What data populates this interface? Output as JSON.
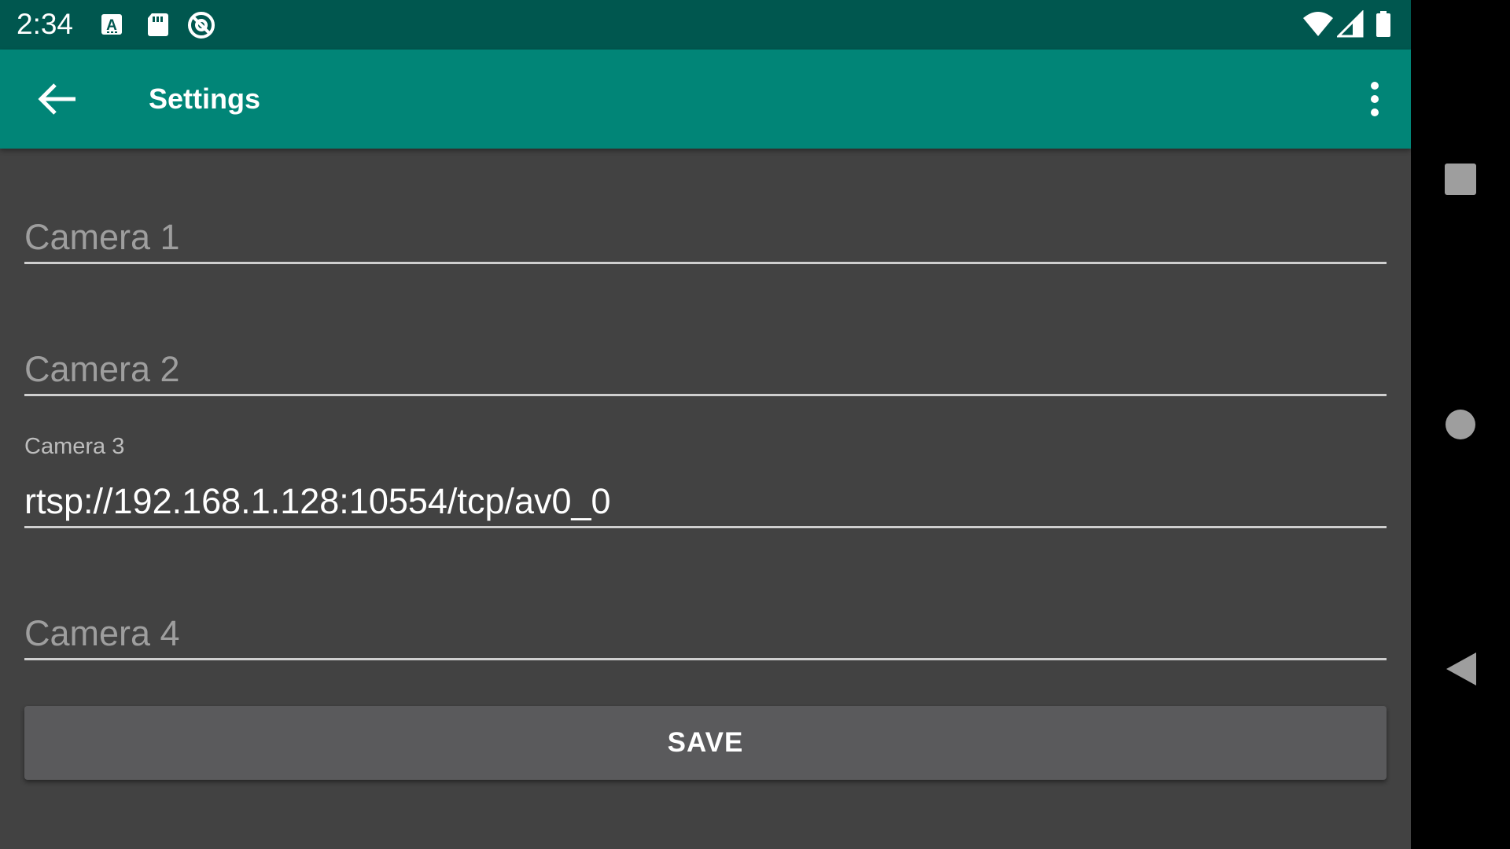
{
  "status_bar": {
    "time": "2:34",
    "left_icons": [
      "keyboard-a-icon",
      "sd-card-icon",
      "blocked-at-icon"
    ],
    "right_icons": [
      "wifi-icon",
      "signal-icon",
      "battery-icon"
    ]
  },
  "app_bar": {
    "title": "Settings",
    "back_icon": "arrow-back-icon",
    "menu_icon": "more-vert-icon"
  },
  "form": {
    "camera1": {
      "label": "Camera 1",
      "value": ""
    },
    "camera2": {
      "label": "Camera 2",
      "value": ""
    },
    "camera3": {
      "label": "Camera 3",
      "value": "rtsp://192.168.1.128:10554/tcp/av0_0"
    },
    "camera4": {
      "label": "Camera 4",
      "value": ""
    },
    "save_label": "SAVE"
  },
  "nav_bar": {
    "icons": [
      "recents-square-icon",
      "home-circle-icon",
      "back-triangle-icon"
    ]
  },
  "colors": {
    "status_bar": "#00574f",
    "app_bar": "#018577",
    "background": "#424242",
    "button": "#5a5a5c"
  }
}
